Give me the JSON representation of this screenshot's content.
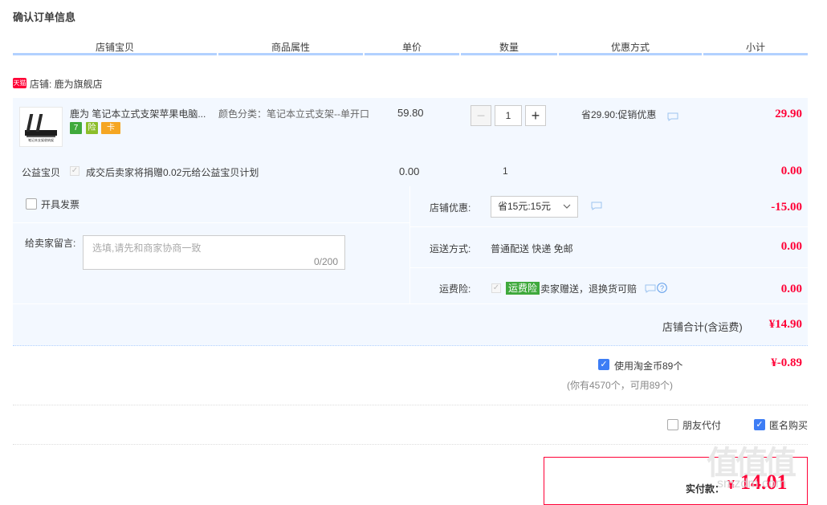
{
  "page_title": "确认订单信息",
  "columns": [
    "店铺宝贝",
    "商品属性",
    "单价",
    "数量",
    "优惠方式",
    "小计"
  ],
  "shop": {
    "badge": "天猫",
    "label": "店铺: 鹿为旗舰店"
  },
  "item": {
    "title": "鹿为 笔记本立式支架苹果电脑...",
    "thumb_caption": "笔记本支架收纳架",
    "icon_labels": [
      "7",
      "险",
      "卡"
    ],
    "attribute": "颜色分类：笔记本立式支架--单开口",
    "price": "59.80",
    "quantity": "1",
    "minus": "−",
    "plus": "+",
    "promo": "省29.90:促销优惠",
    "subtotal": "29.90"
  },
  "charity": {
    "label": "公益宝贝",
    "text": "成交后卖家将捐赠0.02元给公益宝贝计划",
    "price": "0.00",
    "quantity": "1",
    "subtotal": "0.00"
  },
  "invoice": {
    "label": "开具发票"
  },
  "message": {
    "label": "给卖家留言:",
    "placeholder": "选填,请先和商家协商一致",
    "counter": "0/200"
  },
  "shop_discount": {
    "label": "店铺优惠:",
    "selected": "省15元:15元",
    "amount": "-15.00"
  },
  "shipping": {
    "label": "运送方式:",
    "value": "普通配送 快递 免邮",
    "amount": "0.00"
  },
  "insurance": {
    "label": "运费险:",
    "tag": "运费险",
    "text": "卖家赠送，退换货可赔",
    "amount": "0.00"
  },
  "shop_total": {
    "label": "店铺合计(含运费)",
    "amount": "¥14.90"
  },
  "coins": {
    "label": "使用淘金币89个",
    "sub": "(你有4570个，可用89个)",
    "amount": "¥-0.89"
  },
  "options": {
    "friend_pay": "朋友代付",
    "anonymous": "匿名购买"
  },
  "payment": {
    "label": "实付款：",
    "currency": "¥",
    "amount": "14.01"
  },
  "watermark": {
    "logo": "值值值",
    "site": "smzdm.com"
  },
  "colors": {
    "accent_red": "#ff0036",
    "header_line": "#b2d1ff",
    "panel_bg": "#f3f8ff",
    "check_blue": "#3d7df5",
    "green_tag": "#3fa93c"
  }
}
